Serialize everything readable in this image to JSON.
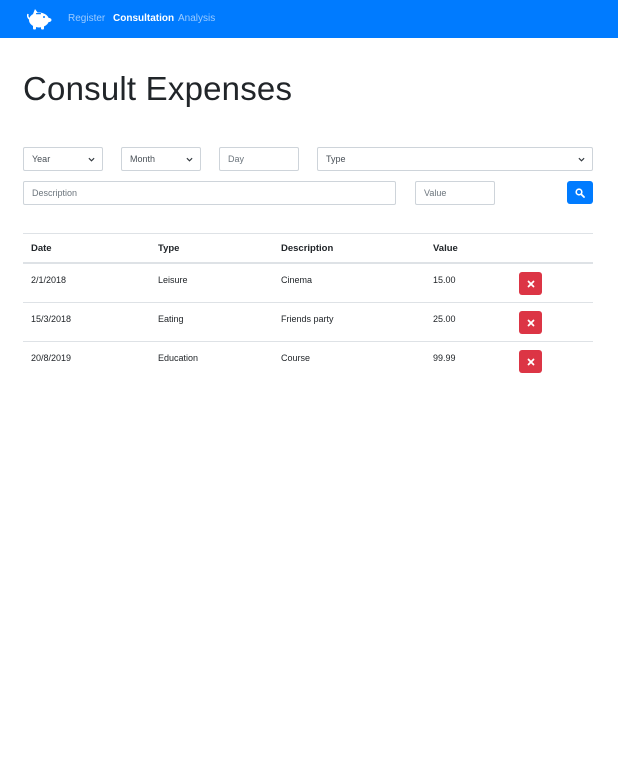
{
  "navbar": {
    "logo_icon": "piggy-bank-icon",
    "links": [
      {
        "label": "Register"
      },
      {
        "label": "Consultation"
      },
      {
        "label": "Analysis"
      }
    ]
  },
  "page": {
    "title": "Consult Expenses"
  },
  "filters": {
    "year": {
      "value": "Year"
    },
    "month": {
      "value": "Month"
    },
    "day": {
      "placeholder": "Day"
    },
    "type": {
      "value": "Type"
    },
    "description": {
      "placeholder": "Description"
    },
    "value": {
      "placeholder": "Value"
    },
    "search_icon": "search-icon"
  },
  "table": {
    "headers": {
      "date": "Date",
      "type": "Type",
      "description": "Description",
      "value": "Value"
    },
    "rows": [
      {
        "date": "2/1/2018",
        "type": "Leisure",
        "description": "Cinema",
        "value": "15.00"
      },
      {
        "date": "15/3/2018",
        "type": "Eating",
        "description": "Friends party",
        "value": "25.00"
      },
      {
        "date": "20/8/2019",
        "type": "Education",
        "description": "Course",
        "value": "99.99"
      }
    ],
    "delete_icon": "close-icon"
  },
  "colors": {
    "primary": "#007bff",
    "danger": "#dc3545",
    "border": "#dee2e6"
  }
}
